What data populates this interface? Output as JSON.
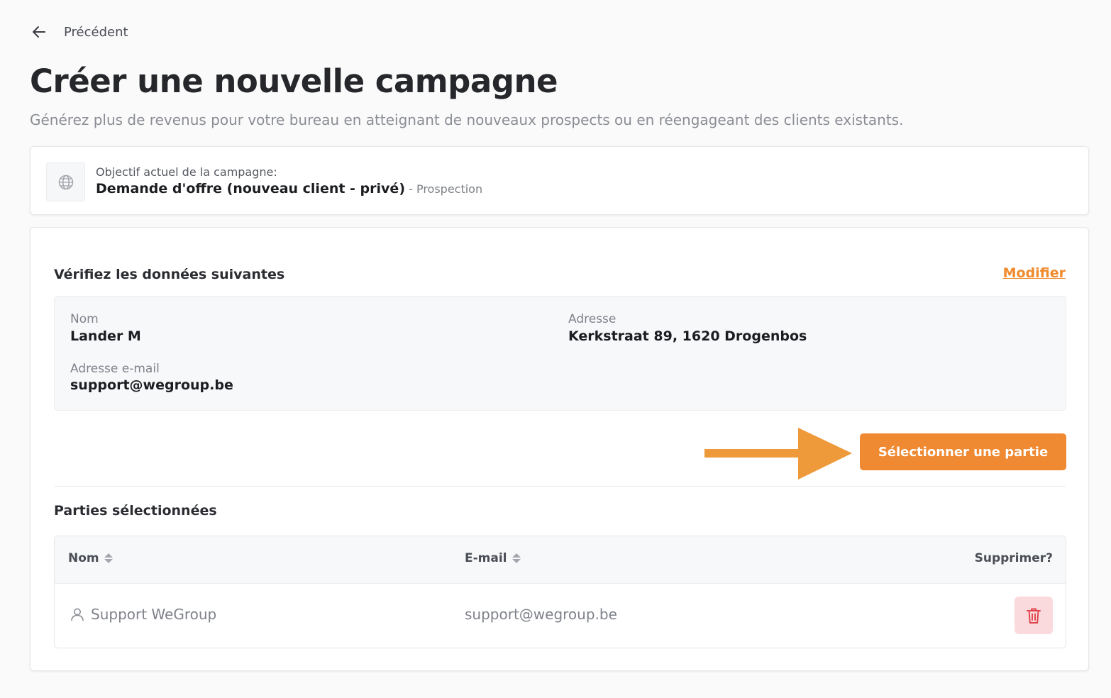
{
  "nav": {
    "back_label": "Précédent"
  },
  "header": {
    "title": "Créer une nouvelle campagne",
    "subtitle": "Générez plus de revenus pour votre bureau en atteignant de nouveaux prospects ou en réengageant des clients existants."
  },
  "objective": {
    "icon": "globe-icon",
    "label": "Objectif actuel de la campagne:",
    "value": "Demande d'offre (nouveau client - privé)",
    "type": " - Prospection"
  },
  "verify": {
    "title": "Vérifiez les données suivantes",
    "modify_label": "Modifier",
    "fields": {
      "name_label": "Nom",
      "name_value": "Lander M",
      "address_label": "Adresse",
      "address_value": "Kerkstraat 89, 1620 Drogenbos",
      "email_label": "Adresse e-mail",
      "email_value": "support@wegroup.be"
    }
  },
  "select_party_label": "Sélectionner une partie",
  "selected_parties": {
    "title": "Parties sélectionnées",
    "columns": {
      "name": "Nom",
      "email": "E-mail",
      "delete": "Supprimer?"
    },
    "rows": [
      {
        "name": "Support WeGroup",
        "email": "support@wegroup.be"
      }
    ]
  },
  "colors": {
    "accent": "#ef8a33",
    "link": "#f08a2c",
    "delete_bg": "#fadadd",
    "delete_icon": "#e0424a"
  }
}
